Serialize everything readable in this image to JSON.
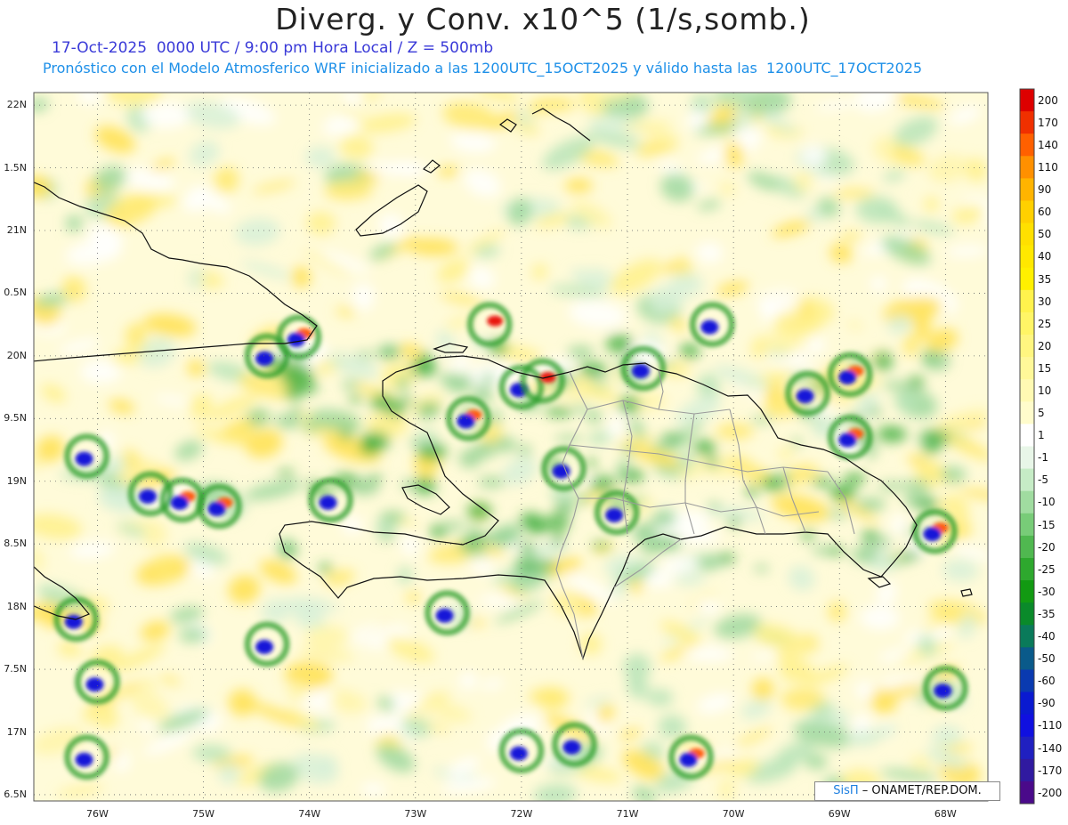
{
  "title": "Diverg. y Conv. x10^5 (1/s,somb.)",
  "subtitle_date": "17-Oct-2025  0000 UTC / 9:00 pm Hora Local / Z = 500mb",
  "subtitle_model": "Pronóstico con el Modelo Atmosferico WRF inicializado a las 1200UTC_15OCT2025 y válido hasta las  1200UTC_17OCT2025",
  "credit": {
    "brand": "SisΠ",
    "text": "– ONAMET/REP.DOM."
  },
  "lat_labels": [
    "22N",
    "1.5N",
    "21N",
    "0.5N",
    "20N",
    "9.5N",
    "19N",
    "8.5N",
    "18N",
    "7.5N",
    "17N",
    "6.5N"
  ],
  "lon_labels": [
    "76W",
    "75W",
    "74W",
    "73W",
    "72W",
    "71W",
    "70W",
    "69W",
    "68W"
  ],
  "colorbar": {
    "labels": [
      "200",
      "170",
      "140",
      "110",
      "90",
      "60",
      "50",
      "40",
      "35",
      "30",
      "25",
      "20",
      "15",
      "10",
      "5",
      "1",
      "-1",
      "-5",
      "-10",
      "-15",
      "-20",
      "-25",
      "-30",
      "-35",
      "-40",
      "-50",
      "-60",
      "-90",
      "-110",
      "-140",
      "-170",
      "-200"
    ],
    "colors": [
      "#dd0000",
      "#f03000",
      "#ff6000",
      "#ff9000",
      "#ffb400",
      "#ffd000",
      "#ffe000",
      "#ffe800",
      "#fff000",
      "#fff24d",
      "#fff566",
      "#fff680",
      "#fff899",
      "#fffab3",
      "#fffccc",
      "#ffffff",
      "#e8f6e8",
      "#c6ecc6",
      "#a0dca0",
      "#78cc78",
      "#50b850",
      "#2ea82e",
      "#129a12",
      "#0a8a2a",
      "#0a7a5a",
      "#0a5a8a",
      "#0a3ab0",
      "#0a1ad0",
      "#1010e0",
      "#2020c0",
      "#301aa0",
      "#4a0a8a"
    ]
  },
  "map_extent": {
    "lon_min": -76.6,
    "lon_max": -67.6,
    "lat_min": 16.45,
    "lat_max": 22.1
  },
  "features": {
    "cyclonic_cells": [
      {
        "lon": -76.1,
        "lat": 19.2,
        "kind": "conv"
      },
      {
        "lon": -75.5,
        "lat": 18.9,
        "kind": "conv"
      },
      {
        "lon": -75.2,
        "lat": 18.85,
        "kind": "mix"
      },
      {
        "lon": -74.85,
        "lat": 18.8,
        "kind": "mix"
      },
      {
        "lon": -74.1,
        "lat": 20.15,
        "kind": "mix"
      },
      {
        "lon": -74.4,
        "lat": 20.0,
        "kind": "conv"
      },
      {
        "lon": -73.8,
        "lat": 18.85,
        "kind": "conv"
      },
      {
        "lon": -72.0,
        "lat": 19.75,
        "kind": "conv"
      },
      {
        "lon": -71.8,
        "lat": 19.8,
        "kind": "div"
      },
      {
        "lon": -72.5,
        "lat": 19.5,
        "kind": "mix"
      },
      {
        "lon": -71.6,
        "lat": 19.1,
        "kind": "conv"
      },
      {
        "lon": -71.1,
        "lat": 18.75,
        "kind": "conv"
      },
      {
        "lon": -69.3,
        "lat": 19.7,
        "kind": "conv"
      },
      {
        "lon": -68.9,
        "lat": 19.85,
        "kind": "mix"
      },
      {
        "lon": -68.9,
        "lat": 19.35,
        "kind": "mix"
      },
      {
        "lon": -68.1,
        "lat": 18.6,
        "kind": "mix"
      },
      {
        "lon": -68.0,
        "lat": 17.35,
        "kind": "conv"
      },
      {
        "lon": -76.2,
        "lat": 17.9,
        "kind": "conv"
      },
      {
        "lon": -76.0,
        "lat": 17.4,
        "kind": "conv"
      },
      {
        "lon": -76.1,
        "lat": 16.8,
        "kind": "conv"
      },
      {
        "lon": -74.4,
        "lat": 17.7,
        "kind": "conv"
      },
      {
        "lon": -72.7,
        "lat": 17.95,
        "kind": "conv"
      },
      {
        "lon": -72.0,
        "lat": 16.85,
        "kind": "conv"
      },
      {
        "lon": -71.5,
        "lat": 16.9,
        "kind": "conv"
      },
      {
        "lon": -70.4,
        "lat": 16.8,
        "kind": "mix"
      },
      {
        "lon": -70.2,
        "lat": 20.25,
        "kind": "conv"
      },
      {
        "lon": -72.3,
        "lat": 20.25,
        "kind": "div"
      },
      {
        "lon": -70.85,
        "lat": 19.9,
        "kind": "conv"
      }
    ]
  }
}
